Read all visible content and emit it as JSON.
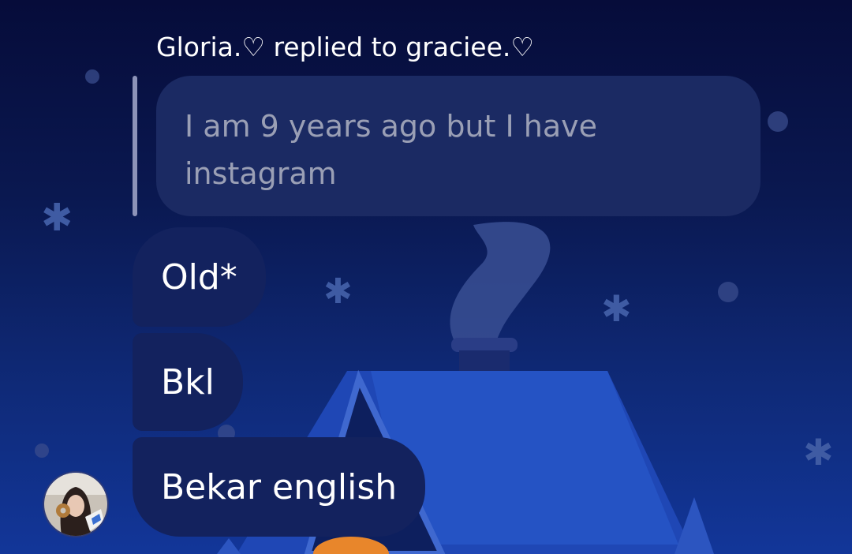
{
  "reply_context": {
    "header": "Gloria.♡ replied to graciee.♡",
    "quoted_message": "I am 9 years ago but I have instagram"
  },
  "messages": [
    {
      "text": "Old*"
    },
    {
      "text": "Bkl"
    },
    {
      "text": "Bekar english"
    }
  ],
  "sender_avatar": {
    "icon": "profile-photo"
  },
  "theme": {
    "bubble_color": "#13225e",
    "quoted_bubble_color": "#1b2a63",
    "background": "#0a1850"
  }
}
